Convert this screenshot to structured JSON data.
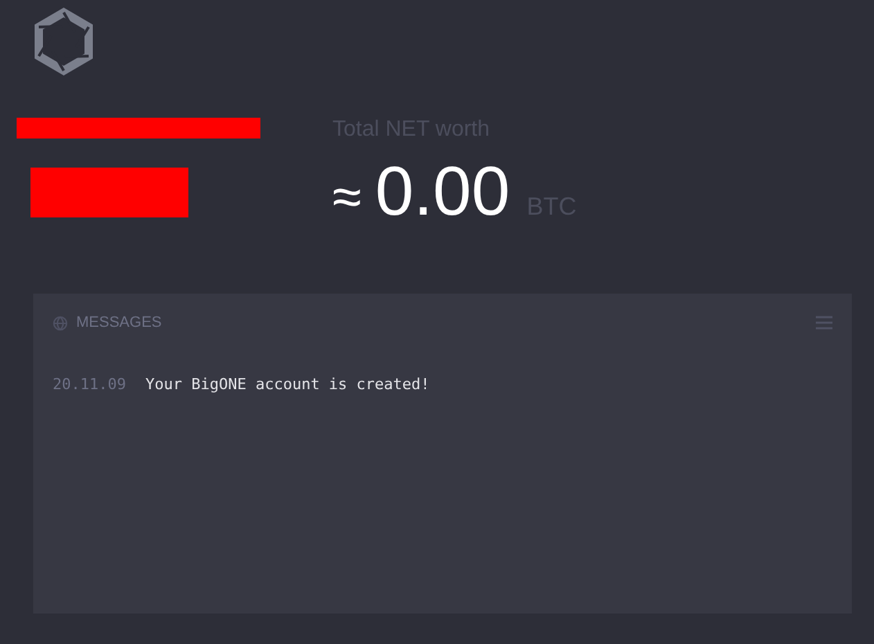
{
  "net_worth": {
    "label": "Total NET worth",
    "approx": "≈",
    "value": "0.00",
    "unit": "BTC"
  },
  "messages": {
    "title": "MESSAGES",
    "items": [
      {
        "date": "20.11.09",
        "text": "Your BigONE account is created!"
      }
    ]
  }
}
